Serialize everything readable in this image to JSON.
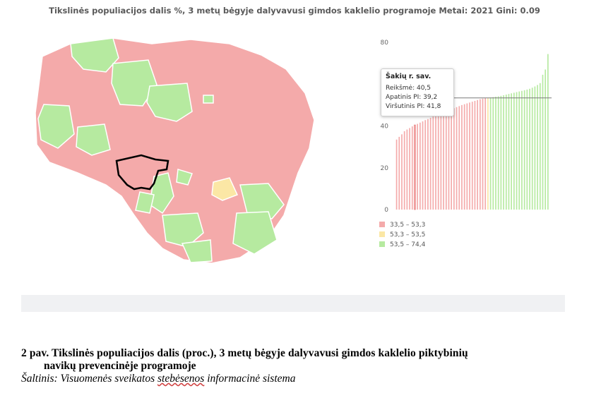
{
  "title": "Tikslinės populiacijos dalis %, 3 metų bėgyje dalyvavusi gimdos kaklelio programoje Metai: 2021 Gini: 0.09",
  "colors": {
    "low": "#f4aaaa",
    "mid": "#fbe7a5",
    "high": "#b6eaa0",
    "selected_border": "#000000",
    "reference_line": "#7a7a7a"
  },
  "tooltip": {
    "name": "Šakių r. sav.",
    "value_label": "Reikšmė: 40,5",
    "lower_label": "Apatinis PI: 39,2",
    "upper_label": "Viršutinis PI: 41,8"
  },
  "chart_data": {
    "type": "bar",
    "ylim": [
      0,
      80
    ],
    "y_ticks": [
      "0",
      "20",
      "40",
      "80"
    ],
    "reference_value": 53.4,
    "legend": [
      {
        "label": "33,5 – 53,3",
        "color": "#f4aaaa"
      },
      {
        "label": "53,3 – 53,5",
        "color": "#fbe7a5"
      },
      {
        "label": "53,5 – 74,4",
        "color": "#b6eaa0"
      }
    ],
    "values": [
      33.5,
      34.8,
      36.0,
      37.5,
      38.3,
      39.0,
      39.8,
      40.5,
      41.0,
      41.6,
      42.2,
      42.8,
      43.3,
      43.9,
      44.5,
      45.0,
      45.5,
      46.0,
      46.5,
      47.0,
      47.5,
      48.0,
      48.5,
      49.0,
      49.5,
      50.0,
      50.4,
      50.8,
      51.2,
      51.6,
      52.0,
      52.4,
      52.8,
      53.1,
      53.3,
      53.4,
      53.6,
      53.8,
      54.0,
      54.2,
      54.4,
      54.7,
      55.0,
      55.3,
      55.6,
      55.9,
      56.2,
      56.5,
      56.8,
      57.1,
      57.4,
      57.8,
      58.3,
      58.9,
      59.6,
      60.5,
      64.5,
      67.0,
      74.4
    ],
    "colors_by_index": [
      "low",
      "low",
      "low",
      "low",
      "low",
      "low",
      "low",
      "low",
      "low",
      "low",
      "low",
      "low",
      "low",
      "low",
      "low",
      "low",
      "low",
      "low",
      "low",
      "low",
      "low",
      "low",
      "low",
      "low",
      "low",
      "low",
      "low",
      "low",
      "low",
      "low",
      "low",
      "low",
      "low",
      "low",
      "low",
      "mid",
      "high",
      "high",
      "high",
      "high",
      "high",
      "high",
      "high",
      "high",
      "high",
      "high",
      "high",
      "high",
      "high",
      "high",
      "high",
      "high",
      "high",
      "high",
      "high",
      "high",
      "high",
      "high",
      "high"
    ],
    "highlight_index": 7
  },
  "caption": {
    "line1": "2 pav. Tikslinės populiacijos dalis (proc.), 3 metų bėgyje dalyvavusi gimdos kaklelio piktybinių",
    "line2": "navikų prevencinėje programoje",
    "source_prefix": "Šaltinis: Visuomenės sveikatos ",
    "source_underlined": "stebėsenos",
    "source_suffix": " informacinė sistema"
  }
}
